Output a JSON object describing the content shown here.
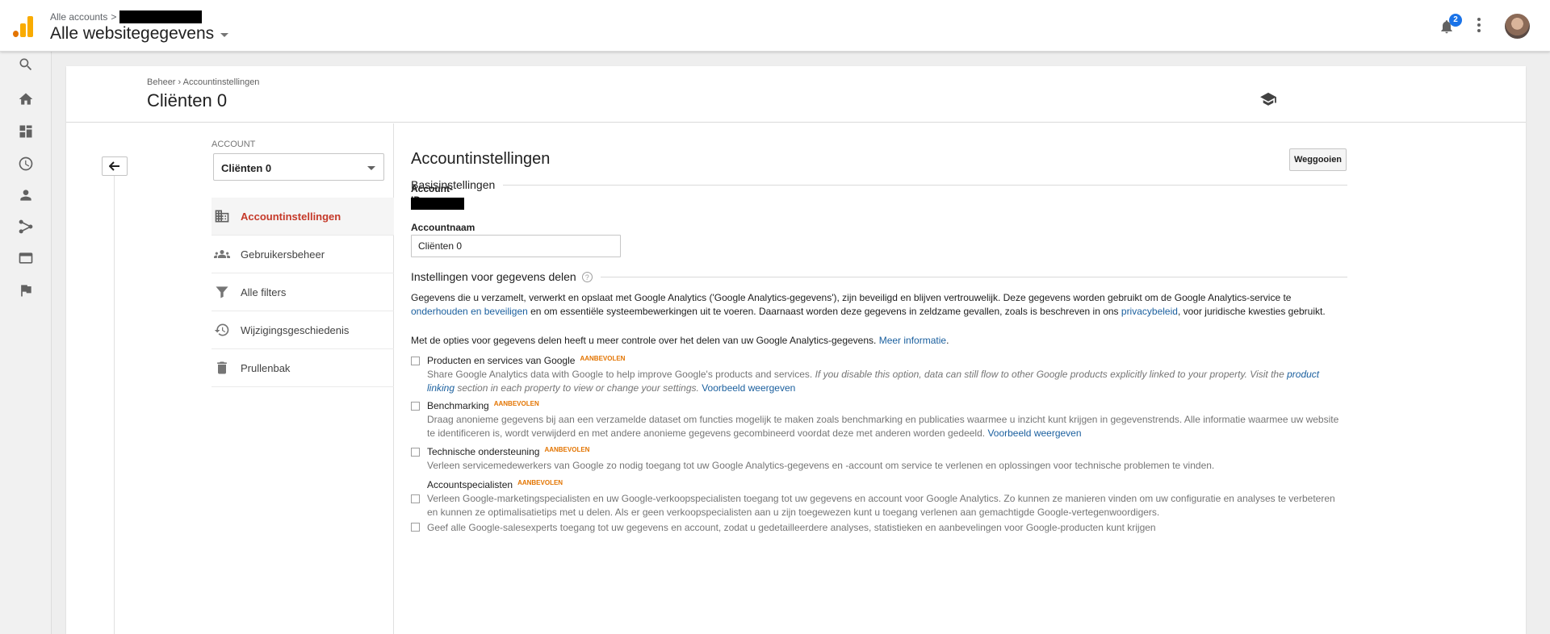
{
  "topbar": {
    "crumb": "Alle accounts",
    "crumb_sep": ">",
    "property": "Alle websitegegevens",
    "notification_count": "2"
  },
  "rail": [
    "search-icon",
    "home-icon",
    "dashboard-icon",
    "clock-icon",
    "person-icon",
    "share-icon",
    "display-icon",
    "flag-icon"
  ],
  "header": {
    "breadcrumb": "Beheer › Accountinstellingen",
    "title": "Cliënten 0"
  },
  "admin": {
    "account_label": "ACCOUNT",
    "account_selected": "Cliënten 0",
    "nav": [
      {
        "label": "Accountinstellingen",
        "icon": "building-icon",
        "active": true
      },
      {
        "label": "Gebruikersbeheer",
        "icon": "users-icon",
        "active": false
      },
      {
        "label": "Alle filters",
        "icon": "filter-icon",
        "active": false
      },
      {
        "label": "Wijzigingsgeschiedenis",
        "icon": "history-icon",
        "active": false
      },
      {
        "label": "Prullenbak",
        "icon": "trash-icon",
        "active": false
      }
    ]
  },
  "content": {
    "title": "Accountinstellingen",
    "discard_label": "Weggooien",
    "basic_heading": "Basisinstellingen",
    "account_id_label": "Account-ID",
    "account_name_label": "Accountnaam",
    "account_name_value": "Cliënten 0",
    "sharing_heading": "Instellingen voor gegevens delen",
    "help_glyph": "?",
    "intro_1a": "Gegevens die u verzamelt, verwerkt en opslaat met Google Analytics ('Google Analytics-gegevens'), zijn beveiligd en blijven vertrouwelijk. Deze gegevens worden gebruikt om de Google Analytics-service te ",
    "intro_1_link1": "onderhouden en beveiligen",
    "intro_1b": " en om essentiële systeembewerkingen uit te voeren. Daarnaast worden deze gegevens in zeldzame gevallen, zoals is beschreven in ons ",
    "intro_1_link2": "privacybeleid",
    "intro_1c": ", voor juridische kwesties gebruikt.",
    "intro_2a": "Met de opties voor gegevens delen heeft u meer controle over het delen van uw Google Analytics-gegevens. ",
    "intro_2_link": "Meer informatie",
    "intro_2b": ".",
    "recommended": "AANBEVOLEN",
    "options": [
      {
        "title": "Producten en services van Google",
        "desc_a": "Share Google Analytics data with Google to help improve Google's products and services. ",
        "desc_italic_a": "If you disable this option, data can still flow to other Google products explicitly linked to your property. Visit the ",
        "desc_italic_link": "product linking",
        "desc_italic_b": " section in each property to view or change your settings.",
        "link": "Voorbeeld weergeven"
      },
      {
        "title": "Benchmarking",
        "desc_a": "Draag anonieme gegevens bij aan een verzamelde dataset om functies mogelijk te maken zoals benchmarking en publicaties waarmee u inzicht kunt krijgen in gegevenstrends. Alle informatie waarmee uw website te identificeren is, wordt verwijderd en met andere anonieme gegevens gecombineerd voordat deze met anderen worden gedeeld. ",
        "link": "Voorbeeld weergeven"
      },
      {
        "title": "Technische ondersteuning",
        "desc_a": "Verleen servicemedewerkers van Google zo nodig toegang tot uw Google Analytics-gegevens en -account om service te verlenen en oplossingen voor technische problemen te vinden."
      },
      {
        "title": "Accountspecialisten",
        "desc_a": "Verleen Google-marketingspecialisten en uw Google-verkoopspecialisten toegang tot uw gegevens en account voor Google Analytics. Zo kunnen ze manieren vinden om uw configuratie en analyses te verbeteren en kunnen ze optimalisatietips met u delen. Als er geen verkoopspecialisten aan u zijn toegewezen kunt u toegang verlenen aan gemachtigde Google-vertegenwoordigers."
      },
      {
        "desc_a": "Geef alle Google-salesexperts toegang tot uw gegevens en account, zodat u gedetailleerdere analyses, statistieken en aanbevelingen voor Google-producten kunt krijgen"
      }
    ]
  },
  "colors": {
    "accent": "#c53929",
    "link": "#1a5f9e",
    "recommended": "#e37400",
    "badge": "#1a73e8"
  }
}
